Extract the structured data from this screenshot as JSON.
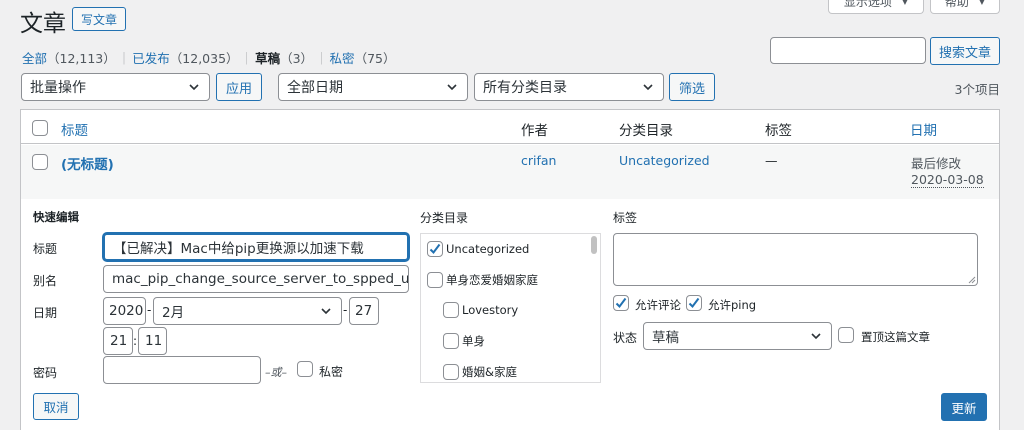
{
  "header": {
    "title": "文章",
    "add_new": "写文章",
    "screen_options": "显示选项",
    "help": "帮助"
  },
  "views": [
    {
      "label": "全部",
      "count": "（12,113）",
      "sep": "｜"
    },
    {
      "label": "已发布",
      "count": "（12,035）",
      "sep": "｜"
    },
    {
      "label": "草稿",
      "count": "（3）",
      "sep": "｜"
    },
    {
      "label": "私密",
      "count": "（75）",
      "sep": ""
    }
  ],
  "search": {
    "value": "",
    "button": "搜索文章"
  },
  "filters": {
    "bulk": "批量操作",
    "apply": "应用",
    "date": "全部日期",
    "category": "所有分类目录",
    "filter": "筛选",
    "count": "3个项目"
  },
  "table": {
    "headers": {
      "title": "标题",
      "author": "作者",
      "categories": "分类目录",
      "tags": "标签",
      "date": "日期"
    },
    "row": {
      "title": "(无标题)",
      "author": "crifan",
      "category": "Uncategorized",
      "tags": "—",
      "date_status": "最后修改",
      "date": "2020-03-08"
    }
  },
  "quick_edit": {
    "heading": "快速编辑",
    "title_label": "标题",
    "title_value": "【已解决】Mac中给pip更换源以加速下载",
    "slug_label": "别名",
    "slug_value": "mac_pip_change_source_server_to_spped_up_download",
    "date_label": "日期",
    "year": "2020",
    "month": "2月",
    "day": "27",
    "hour": "21",
    "minute": "11",
    "date_dash": "-",
    "time_colon": ":",
    "password_label": "密码",
    "password_value": "",
    "or": "–或–",
    "private": "私密",
    "categories_label": "分类目录",
    "categories": [
      {
        "label": "Uncategorized",
        "checked": true,
        "level": 0
      },
      {
        "label": "单身恋爱婚姻家庭",
        "checked": false,
        "level": 0
      },
      {
        "label": "Lovestory",
        "checked": false,
        "level": 1
      },
      {
        "label": "单身",
        "checked": false,
        "level": 1
      },
      {
        "label": "婚姻&家庭",
        "checked": false,
        "level": 1
      }
    ],
    "tags_label": "标签",
    "allow_comments": "允许评论",
    "allow_pings": "允许ping",
    "status_label": "状态",
    "status_value": "草稿",
    "sticky": "置顶这篇文章",
    "cancel": "取消",
    "update": "更新"
  },
  "colors": {
    "accent": "#2271b1",
    "background": "#f0f0f1",
    "border": "#c3c4c7"
  }
}
